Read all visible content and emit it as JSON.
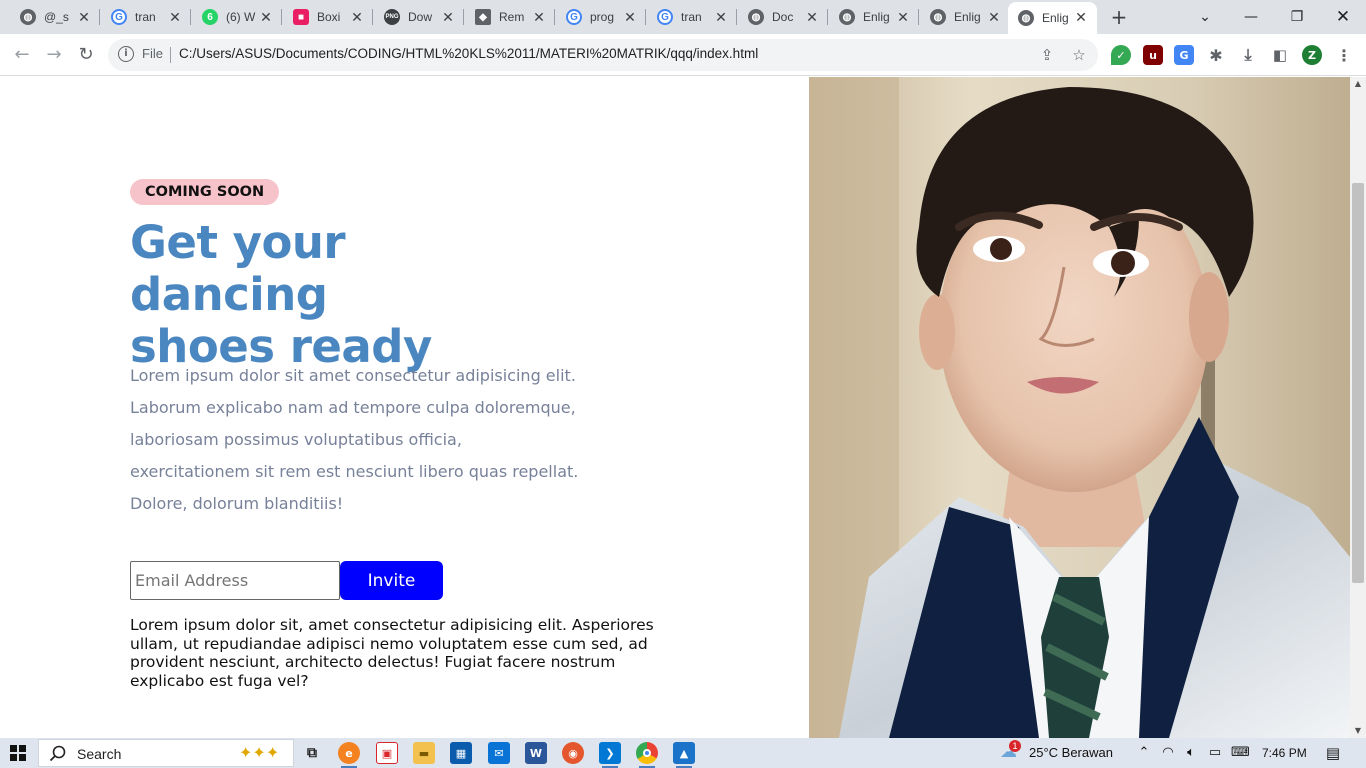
{
  "browser": {
    "tabs": [
      {
        "title": "@_s",
        "icon": "globe-icon",
        "color": "#5f6368"
      },
      {
        "title": "tran",
        "icon": "google-icon",
        "color": "#4285f4"
      },
      {
        "title": "(6) W",
        "icon": "whatsapp-icon",
        "color": "#25d366"
      },
      {
        "title": "Boxi",
        "icon": "boxicons-icon",
        "color": "#e91e63"
      },
      {
        "title": "Dow",
        "icon": "png-icon",
        "color": "#3c4043"
      },
      {
        "title": "Rem",
        "icon": "layers-icon",
        "color": "#5f6368"
      },
      {
        "title": "prog",
        "icon": "google-icon",
        "color": "#4285f4"
      },
      {
        "title": "tran",
        "icon": "google-icon",
        "color": "#4285f4"
      },
      {
        "title": "Doc",
        "icon": "globe-icon",
        "color": "#5f6368"
      },
      {
        "title": "Enlig",
        "icon": "globe-icon",
        "color": "#5f6368"
      },
      {
        "title": "Enlig",
        "icon": "globe-icon",
        "color": "#5f6368"
      },
      {
        "title": "Enlig",
        "icon": "globe-icon",
        "color": "#5f6368",
        "active": true
      }
    ],
    "address": {
      "scheme_label": "File",
      "url": "C:/Users/ASUS/Documents/CODING/HTML%20KLS%2011/MATERI%20MATRIK/qqq/index.html"
    },
    "profile_initial": "Z"
  },
  "page": {
    "badge": "COMING SOON",
    "title_line1": "Get your dancing",
    "title_line2": "shoes ready",
    "description_lines": [
      "Lorem ipsum dolor sit amet consectetur adipisicing elit.",
      "Laborum explicabo nam ad tempore culpa doloremque,",
      "laboriosam possimus voluptatibus officia,",
      "exercitationem sit rem est nesciunt libero quas repellat.",
      "Dolore, dolorum blanditiis!"
    ],
    "email_placeholder": "Email Address",
    "invite_label": "Invite",
    "footer_text": "Lorem ipsum dolor sit, amet consectetur adipisicing elit. Asperiores ullam, ut repudiandae adipisci nemo voluptatem esse cum sed, ad provident nesciunt, architecto delectus! Fugiat facere nostrum explicabo est fuga vel?",
    "accent_color": "#4a86c0",
    "button_color": "#0000ff",
    "badge_color": "#f7c3ca"
  },
  "taskbar": {
    "search_label": "Search",
    "weather": "25°C  Berawan",
    "weather_badge": "1",
    "time": "7:46 PM"
  }
}
